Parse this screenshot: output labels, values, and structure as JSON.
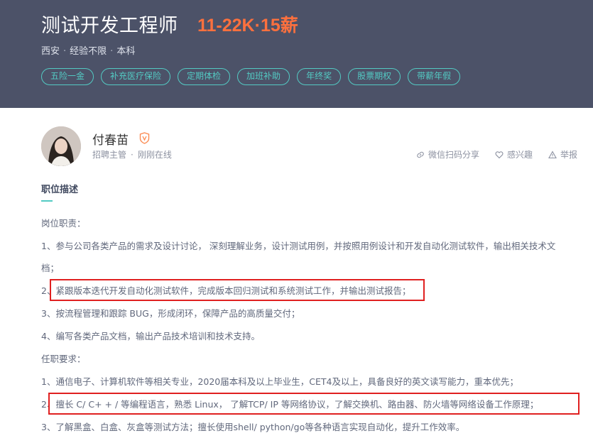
{
  "job": {
    "title": "测试开发工程师",
    "salary": "11-22K·15薪",
    "location": "西安",
    "experience": "经验不限",
    "education": "本科",
    "separator": "·",
    "benefits": [
      "五险一金",
      "补充医疗保险",
      "定期体检",
      "加班补助",
      "年终奖",
      "股票期权",
      "带薪年假"
    ]
  },
  "recruiter": {
    "name": "付春苗",
    "role": "招聘主管",
    "status": "刚刚在线",
    "separator": "·"
  },
  "actions": {
    "share_label": "微信扫码分享",
    "interest_label": "感兴趣",
    "report_label": "举报"
  },
  "description": {
    "section_title": "职位描述",
    "duties_heading": "岗位职责：",
    "duties": [
      "1、参与公司各类产品的需求及设计讨论， 深刻理解业务，设计测试用例，并按照用例设计和开发自动化测试软件，输出相关技术文",
      "档；",
      "2、紧跟版本迭代开发自动化测试软件，完成版本回归测试和系统测试工作，并输出测试报告；",
      "3、按流程管理和跟踪 BUG，形成闭环，保障产品的高质量交付；",
      "4、编写各类产品文档，输出产品技术培训和技术支持。"
    ],
    "requirements_heading": "任职要求：",
    "requirements": [
      "1、通信电子、计算机软件等相关专业，2020届本科及以上毕业生，CET4及以上，具备良好的英文读写能力，重本优先；",
      "2、擅长 C/ C+ + / 等编程语言，熟悉 Linux， 了解TCP/ IP 等网络协议，了解交换机、路由器、防火墙等网络设备工作原理；",
      "3、了解黑盒、白盒、灰盒等测试方法；擅长使用shell/ python/go等各种语言实现自动化，提升工作效率。"
    ]
  },
  "colors": {
    "header_bg": "#4c5268",
    "salary": "#fc703e",
    "tag": "#53cac3",
    "highlight_box": "#e02020"
  }
}
